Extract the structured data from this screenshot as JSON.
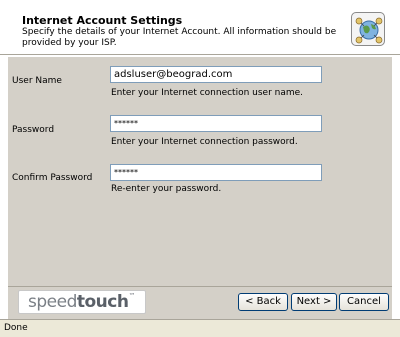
{
  "header": {
    "title": "Internet Account Settings",
    "description": "Specify the details of your Internet Account. All information should be provided by your ISP."
  },
  "form": {
    "username": {
      "label": "User Name",
      "value": "adsluser@beograd.com",
      "hint": "Enter your Internet connection user name."
    },
    "password": {
      "label": "Password",
      "value": "******",
      "hint": "Enter your Internet connection password."
    },
    "confirm": {
      "label": "Confirm Password",
      "value": "******",
      "hint": "Re-enter your password."
    }
  },
  "footer": {
    "logo_light": "speed",
    "logo_bold": "touch",
    "logo_tm": "™",
    "back_label": "< Back",
    "next_label": "Next >",
    "cancel_label": "Cancel"
  },
  "status": {
    "text": "Done"
  },
  "icons": {
    "header_icon": "globe-network-icon"
  }
}
